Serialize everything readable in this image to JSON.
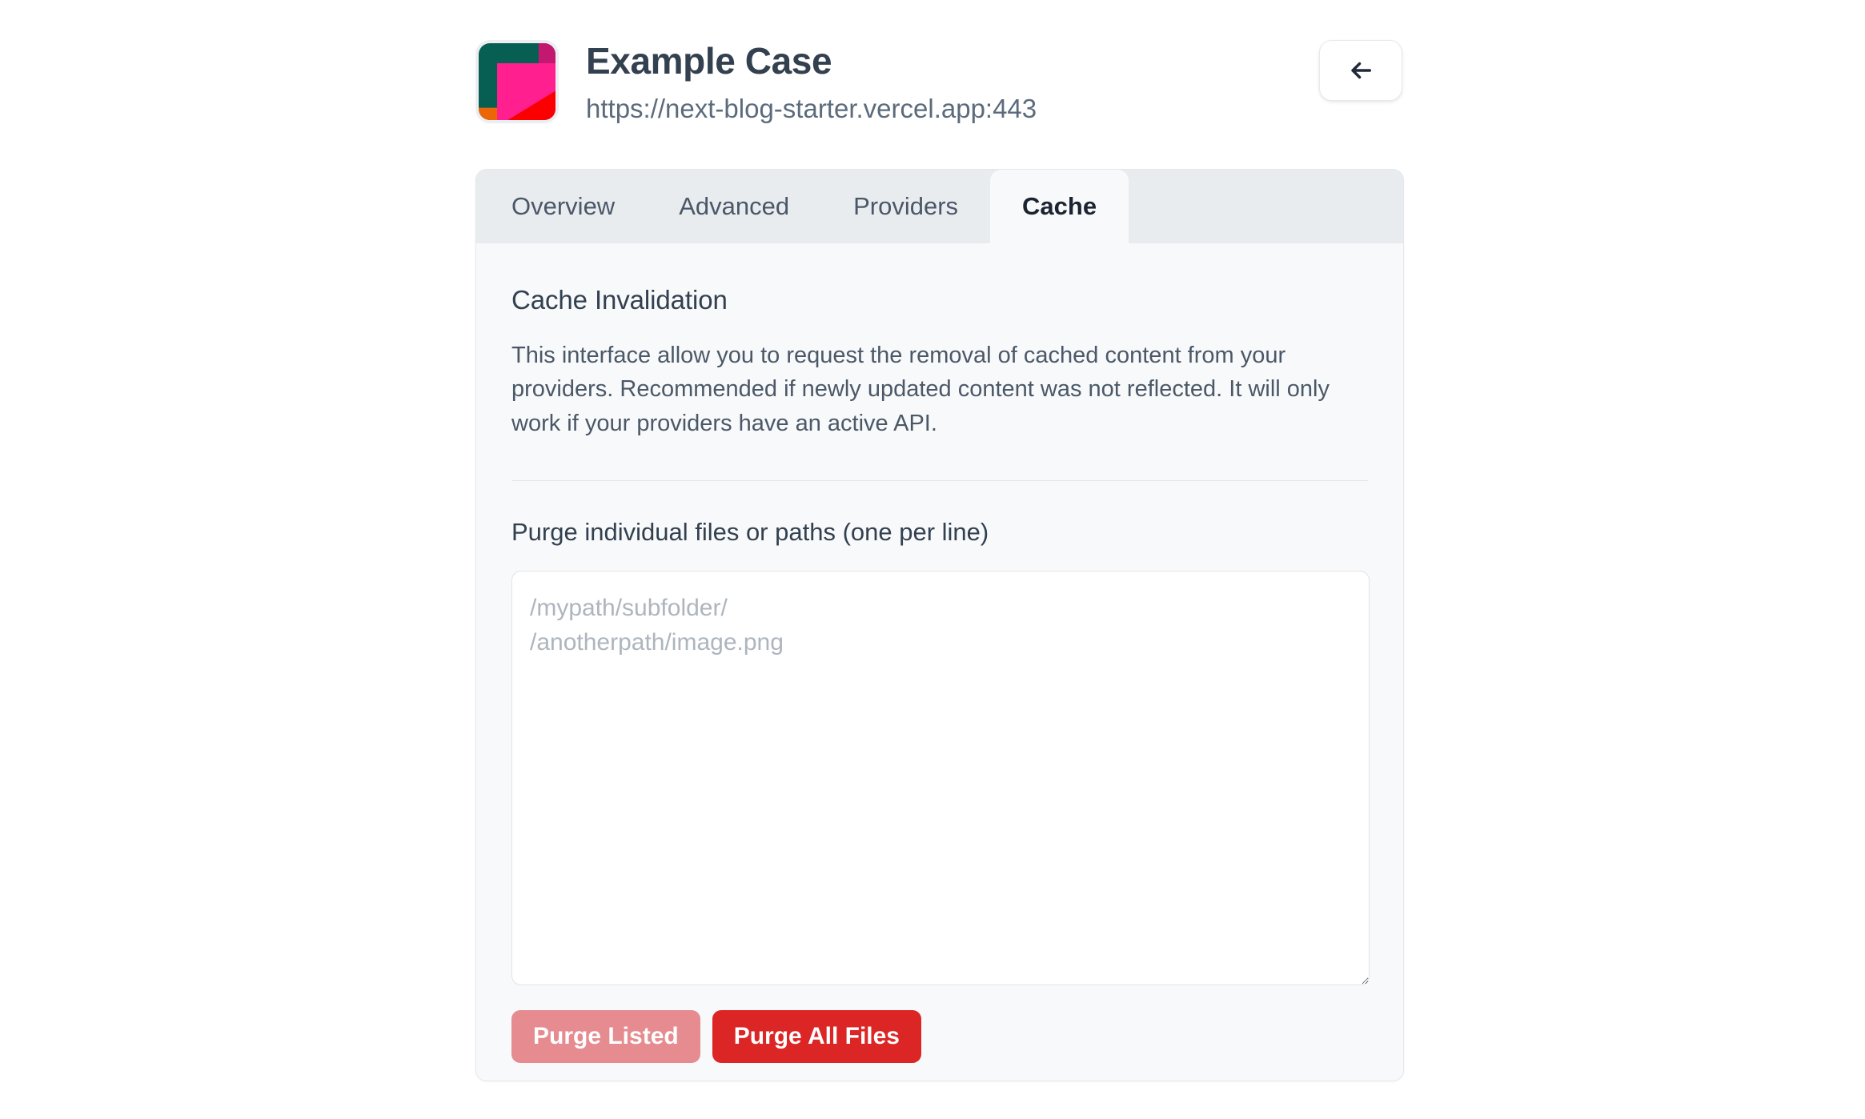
{
  "header": {
    "title": "Example Case",
    "url": "https://next-blog-starter.vercel.app:443",
    "logo_icon": "app-logo-icon",
    "back_icon": "arrow-left-icon",
    "back_label": ""
  },
  "tabs": [
    {
      "label": "Overview",
      "active": false
    },
    {
      "label": "Advanced",
      "active": false
    },
    {
      "label": "Providers",
      "active": false
    },
    {
      "label": "Cache",
      "active": true
    }
  ],
  "cache_panel": {
    "section_title": "Cache Invalidation",
    "description": "This interface allow you to request the removal of cached content from your providers. Recommended if newly updated content was not reflected. It will only work if your providers have an active API.",
    "field_label": "Purge individual files or paths (one per line)",
    "textarea_value": "",
    "textarea_placeholder": "/mypath/subfolder/\n/anotherpath/image.png",
    "buttons": {
      "purge_listed": "Purge Listed",
      "purge_all": "Purge All Files"
    }
  },
  "colors": {
    "page_background": "#ffffff",
    "card_background": "#f8f9fb",
    "tabbar_background": "#e9ecef",
    "title_text": "#33404f",
    "body_text": "#4b5867",
    "placeholder_text": "#adb5bd",
    "danger": "#dc2626",
    "danger_muted": "#e68c90",
    "logo_teal": "#065f52",
    "logo_magenta": "#ff1f8f",
    "logo_dark_magenta": "#c2186f",
    "logo_red": "#fa0000",
    "logo_orange": "#ec6608"
  }
}
